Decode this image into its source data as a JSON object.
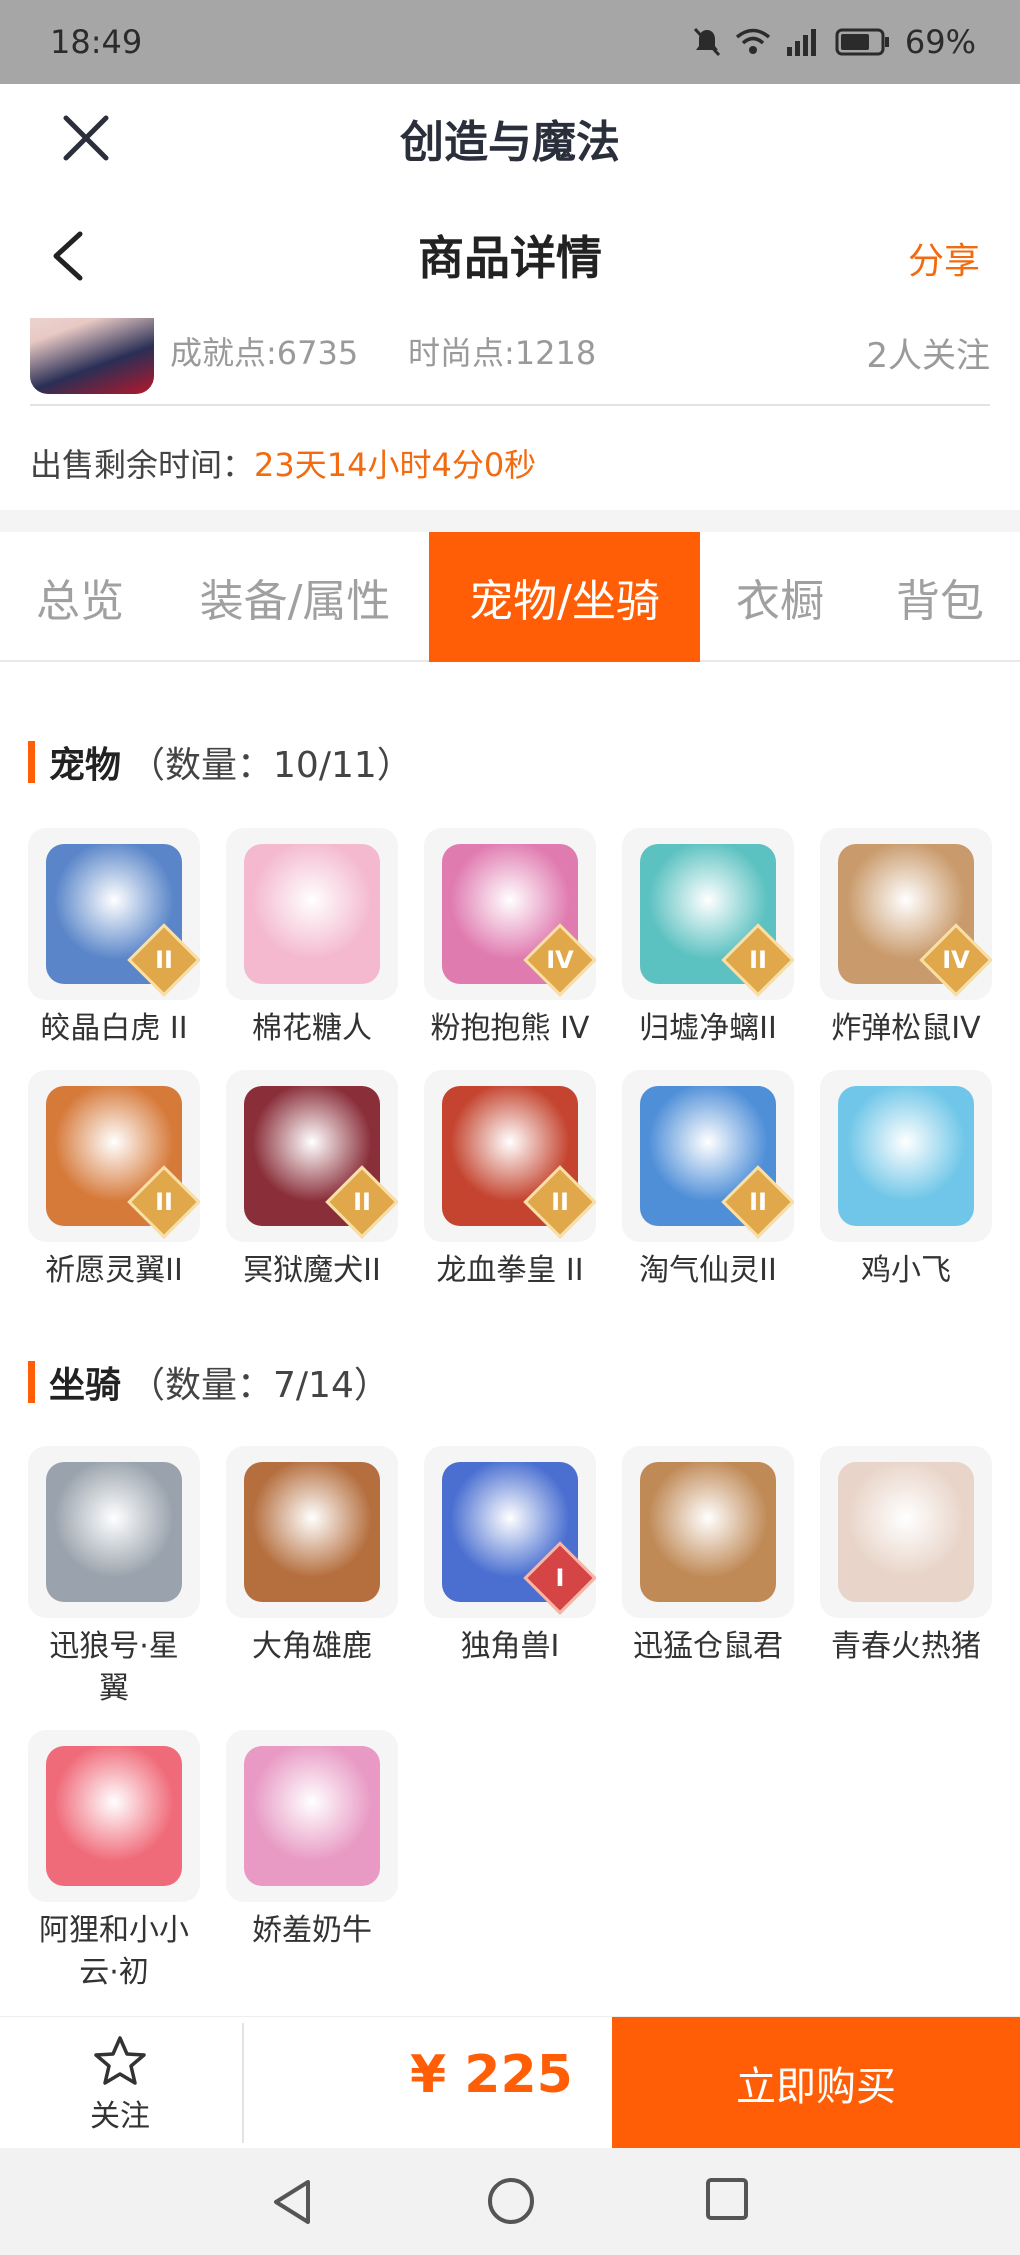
{
  "status_bar": {
    "time": "18:49",
    "battery": "69%",
    "network": "4G"
  },
  "app_bar": {
    "title": "创造与魔法"
  },
  "nav_bar": {
    "title": "商品详情",
    "share": "分享"
  },
  "seller": {
    "achievement": "成就点:6735",
    "fashion": "时尚点:1218",
    "followers": "2人关注"
  },
  "sale": {
    "label": "出售剩余时间：",
    "remaining": "23天14小时4分0秒"
  },
  "tabs": [
    {
      "label": "总览",
      "active": false
    },
    {
      "label": "装备/属性",
      "active": false
    },
    {
      "label": "宠物/坐骑",
      "active": true
    },
    {
      "label": "衣橱",
      "active": false
    },
    {
      "label": "背包",
      "active": false
    }
  ],
  "pets_section": {
    "title": "宠物",
    "count": "（数量：10/11）"
  },
  "pets": [
    {
      "name": "皎晶白虎 II",
      "badge": "II",
      "color": "#5a86c9"
    },
    {
      "name": "棉花糖人",
      "badge": "",
      "color": "#f4b9cf"
    },
    {
      "name": "粉抱抱熊 IV",
      "badge": "IV",
      "color": "#e07bb0"
    },
    {
      "name": "归墟净螭II",
      "badge": "II",
      "color": "#5cc1c1"
    },
    {
      "name": "炸弹松鼠IV",
      "badge": "IV",
      "color": "#c99a6b"
    },
    {
      "name": "祈愿灵翼II",
      "badge": "II",
      "color": "#d67a3a"
    },
    {
      "name": "冥狱魔犬II",
      "badge": "II",
      "color": "#8a2f3a"
    },
    {
      "name": "龙血拳皇 II",
      "badge": "II",
      "color": "#c4442f"
    },
    {
      "name": "淘气仙灵II",
      "badge": "II",
      "color": "#4f8fd8"
    },
    {
      "name": "鸡小飞",
      "badge": "",
      "color": "#6fc6e8"
    }
  ],
  "mounts_section": {
    "title": "坐骑",
    "count": "（数量：7/14）"
  },
  "mounts": [
    {
      "name_line1": "迅狼号·星",
      "name_line2": "翼",
      "badge": "",
      "color": "#9aa3ad"
    },
    {
      "name_line1": "大角雄鹿",
      "name_line2": "",
      "badge": "",
      "color": "#b56f3f"
    },
    {
      "name_line1": "独角兽I",
      "name_line2": "",
      "badge": "I",
      "color": "#4a6fd1"
    },
    {
      "name_line1": "迅猛仓鼠君",
      "name_line2": "",
      "badge": "",
      "color": "#c08a57"
    },
    {
      "name_line1": "青春火热猪",
      "name_line2": "",
      "badge": "",
      "color": "#e8d4c8"
    },
    {
      "name_line1": "阿狸和小小",
      "name_line2": "云·初",
      "badge": "",
      "color": "#f06b7a"
    },
    {
      "name_line1": "娇羞奶牛",
      "name_line2": "",
      "badge": "",
      "color": "#e89ac4"
    }
  ],
  "bottom_bar": {
    "follow": "关注",
    "price": "¥ 225",
    "buy": "立即购买"
  },
  "colors": {
    "accent": "#ff5e07",
    "accent_text": "#f26b10"
  }
}
